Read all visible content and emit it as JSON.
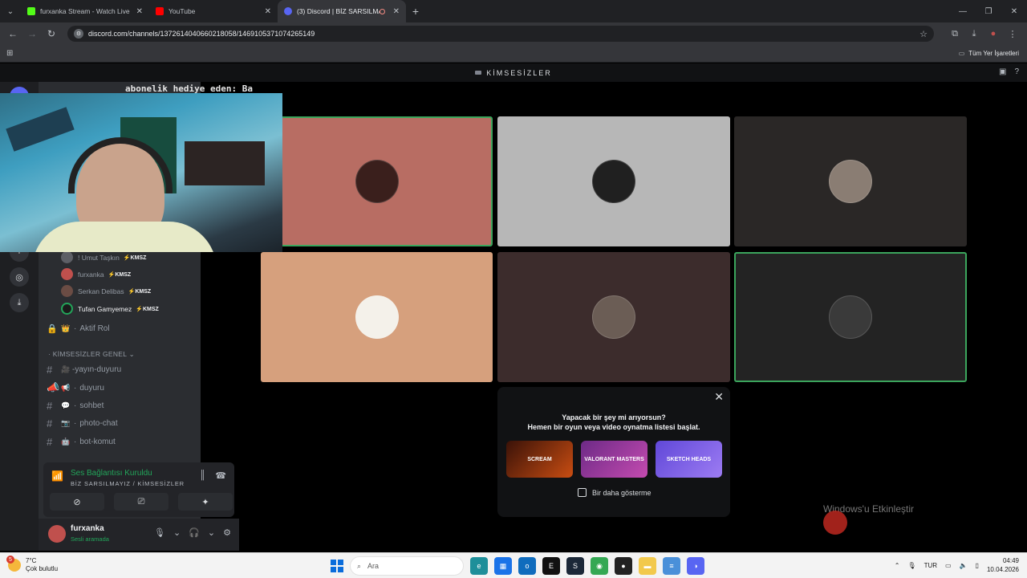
{
  "browser": {
    "tabs": [
      {
        "title": "furxanka Stream - Watch Live o",
        "color": "#53fc18"
      },
      {
        "title": "YouTube",
        "color": "#ff0000"
      },
      {
        "title": "(3) Discord | BİZ SARSILMA",
        "color": "#5865f2"
      }
    ],
    "new_tab": "+",
    "url": "discord.com/channels/1372614040660218058/1469105371074265149",
    "bookmarks_label": "Tüm Yer İşaretleri"
  },
  "discord": {
    "server_title": "KİMSESİZLER",
    "voice_members": [
      {
        "name": "! Umut Taşkın",
        "tag": "KMSZ",
        "bright": false
      },
      {
        "name": "furxanka",
        "tag": "KMSZ",
        "bright": false
      },
      {
        "name": "Serkan Delibas",
        "tag": "KMSZ",
        "bright": false
      },
      {
        "name": "Tufan Gamyemez",
        "tag": "KMSZ",
        "bright": true
      }
    ],
    "role_channel": "Aktif Rol",
    "category": "KİMSESİZLER GENEL",
    "channels": [
      {
        "emoji": "🎥",
        "name": "-yayın-duyuru"
      },
      {
        "emoji": "📢",
        "name": "duyuru"
      },
      {
        "emoji": "💬",
        "name": "sohbet"
      },
      {
        "emoji": "📷",
        "name": "photo-chat"
      },
      {
        "emoji": "🤖",
        "name": "bot-komut"
      }
    ],
    "voice_status": "Ses Bağlantısı Kuruldu",
    "voice_location": "BİZ SARSILMAYIZ / KİMSESİZLER",
    "user": {
      "name": "furxanka",
      "status": "Sesli aramada"
    },
    "activity": {
      "line1": "Yapacak bir şey mi arıyorsun?",
      "line2": "Hemen bir oyun veya video oynatma listesi başlat.",
      "games": [
        "SCREAM",
        "VALORANT MASTERS",
        "SKETCH HEADS"
      ],
      "dont_show": "Bir daha gösterme"
    }
  },
  "overlay": {
    "ticker": "abonelik hediye eden: Ba",
    "partial_title": "KİMSESİZLER"
  },
  "windows_watermark": "Windows'u Etkinleştir",
  "taskbar": {
    "weather_temp": "7°C",
    "weather_desc": "Çok bulutlu",
    "weather_badge": "5",
    "search_placeholder": "Ara",
    "language": "TUR",
    "time": "04:49",
    "date": "10.04.2026"
  },
  "colors": {
    "discord_green": "#23a55a",
    "speaking_border": "#3ba55c"
  }
}
